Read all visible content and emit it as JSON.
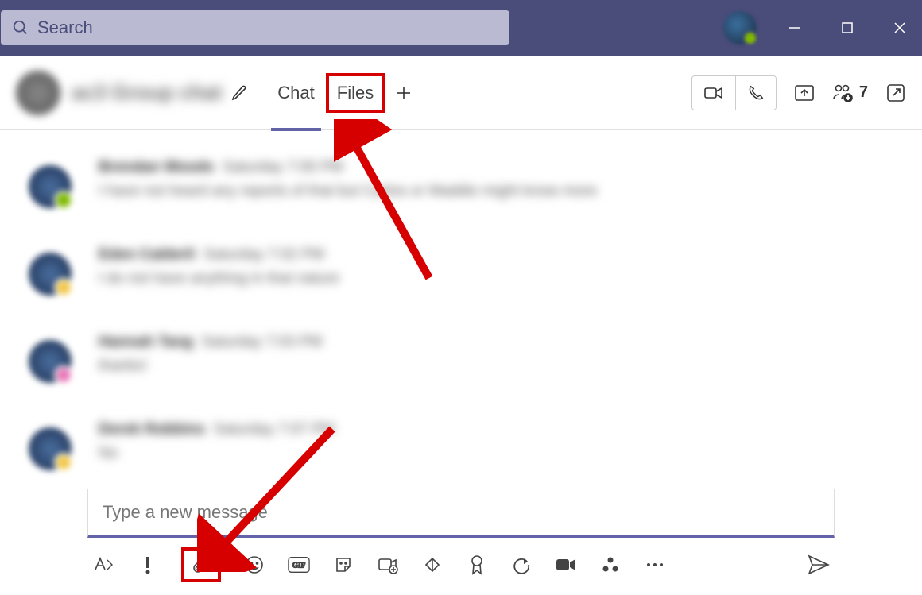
{
  "titlebar": {
    "search_placeholder": "Search"
  },
  "chat_header": {
    "title_blurred": "ac3 Group chat",
    "tabs": [
      {
        "label": "Chat",
        "active": true
      },
      {
        "label": "Files",
        "active": false,
        "highlight": true
      }
    ],
    "participants_count": "7"
  },
  "messages": [
    {
      "name": "Brendan Woods",
      "time": "Saturday 7:00 PM",
      "text": "I have not heard any reports of that but Carlos or Maddie might know more",
      "badge": "green"
    },
    {
      "name": "Eden Calderli",
      "time": "Saturday 7:02 PM",
      "text": "I do not have anything in that nature",
      "badge": "yellow"
    },
    {
      "name": "Hannah Tang",
      "time": "Saturday 7:03 PM",
      "text": "thanks!",
      "badge": "pink"
    },
    {
      "name": "Derek Robbins",
      "time": "Saturday 7:07 PM",
      "text": "No",
      "badge": "yellow"
    }
  ],
  "compose": {
    "placeholder": "Type a new message"
  },
  "annotations": {
    "highlight_color": "#d60000"
  }
}
